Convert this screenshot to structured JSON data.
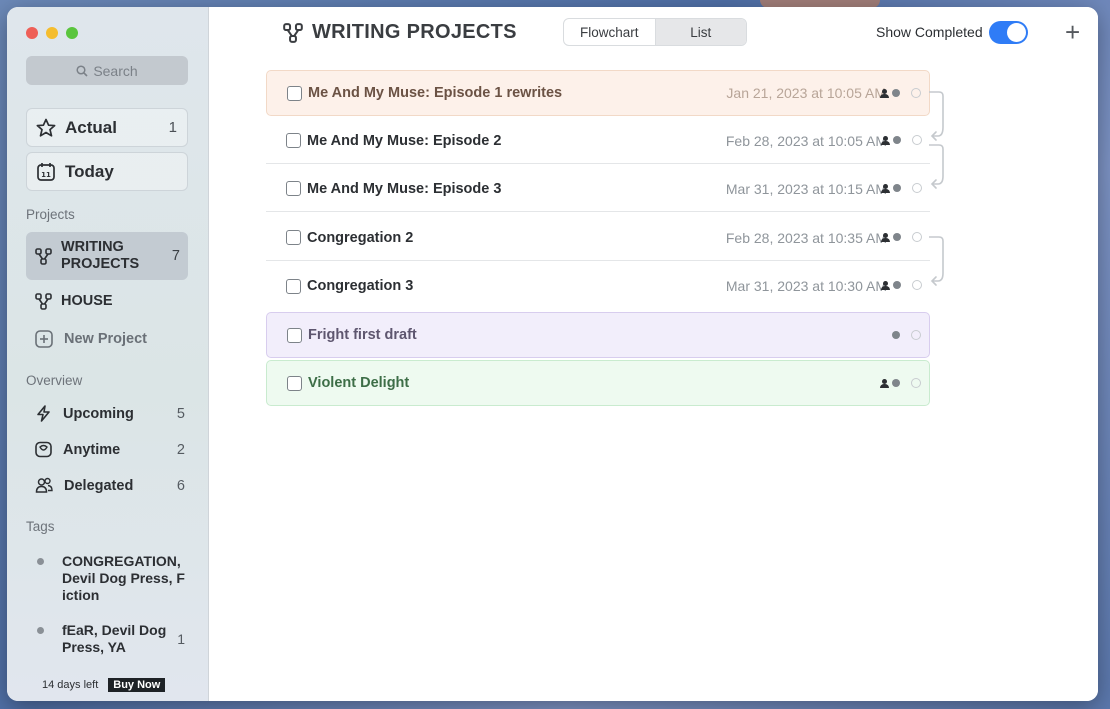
{
  "sidebar": {
    "search_label": "Search",
    "actual": {
      "label": "Actual",
      "count": "1"
    },
    "today": {
      "label": "Today"
    },
    "projects_header": "Projects",
    "projects": [
      {
        "label": "WRITING PROJECTS",
        "count": "7",
        "active": true
      },
      {
        "label": "HOUSE",
        "count": ""
      }
    ],
    "new_project_label": "New Project",
    "overview_header": "Overview",
    "overview": [
      {
        "label": "Upcoming",
        "count": "5"
      },
      {
        "label": "Anytime",
        "count": "2"
      },
      {
        "label": "Delegated",
        "count": "6"
      }
    ],
    "tags_header": "Tags",
    "tags": [
      {
        "label": "CONGREGATION, Devil Dog Press, Fiction",
        "count": ""
      },
      {
        "label": "fEaR, Devil Dog Press, YA",
        "count": "1"
      }
    ],
    "trial_text": "14 days left",
    "buy_label": "Buy Now"
  },
  "header": {
    "title": "WRITING PROJECTS",
    "view_tabs": [
      {
        "label": "Flowchart",
        "selected": false
      },
      {
        "label": "List",
        "selected": true
      }
    ],
    "show_completed_label": "Show Completed",
    "show_completed_on": true,
    "add_label": "+"
  },
  "tasks": [
    {
      "name": "Me And My Muse: Episode 1 rewrites",
      "date": "Jan 21, 2023 at 10:05 AM",
      "color": "peach",
      "delegated": true
    },
    {
      "name": "Me And My Muse: Episode 2",
      "date": "Feb 28, 2023 at 10:05 AM",
      "color": "plain",
      "delegated": true
    },
    {
      "name": "Me And My Muse: Episode 3",
      "date": "Mar 31, 2023 at 10:15 AM",
      "color": "plain",
      "delegated": true
    },
    {
      "name": "Congregation 2",
      "date": "Feb 28, 2023 at 10:35 AM",
      "color": "plain",
      "delegated": true
    },
    {
      "name": "Congregation 3",
      "date": "Mar 31, 2023 at 10:30 AM",
      "color": "plain",
      "delegated": true
    },
    {
      "name": "Fright first draft",
      "date": "",
      "color": "lav",
      "delegated": false
    },
    {
      "name": "Violent Delight",
      "date": "",
      "color": "mint",
      "delegated": true
    }
  ],
  "colors": {
    "accent": "#2f7cf6",
    "peach": "#fdf1ea",
    "lavender": "#f2eefb",
    "mint": "#eefaf0"
  }
}
